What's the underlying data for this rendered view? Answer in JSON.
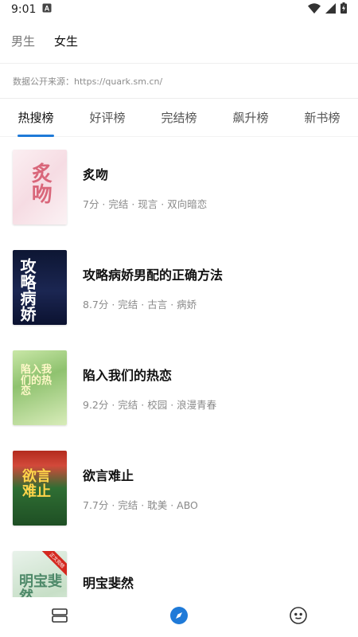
{
  "status_bar": {
    "time": "9:01",
    "icons": [
      "notification-a-icon",
      "wifi-icon",
      "signal-icon",
      "battery-charging-icon"
    ]
  },
  "gender_tabs": [
    {
      "label": "男生",
      "active": false
    },
    {
      "label": "女生",
      "active": true
    }
  ],
  "source_text": "数据公开来源：https://quark.sm.cn/",
  "rank_tabs": [
    {
      "label": "热搜榜",
      "active": true
    },
    {
      "label": "好评榜",
      "active": false
    },
    {
      "label": "完结榜",
      "active": false
    },
    {
      "label": "飙升榜",
      "active": false
    },
    {
      "label": "新书榜",
      "active": false
    }
  ],
  "books": [
    {
      "title": "炙吻",
      "meta": "7分 · 完结 · 现言 · 双向暗恋",
      "cover_text": "炙吻"
    },
    {
      "title": "攻略病娇男配的正确方法",
      "meta": "8.7分 · 完结 · 古言 · 病娇",
      "cover_text": "攻略病娇"
    },
    {
      "title": "陷入我们的热恋",
      "meta": "9.2分 · 完结 · 校园 · 浪漫青春",
      "cover_text": "陷入我们的热恋"
    },
    {
      "title": "欲言难止",
      "meta": "7.7分 · 完结 · 耽美 · ABO",
      "cover_text": "欲言难止"
    },
    {
      "title": "明宝斐然",
      "meta": "",
      "cover_text": "明宝斐然",
      "ribbon_text": "正文完结"
    }
  ],
  "bottom_nav": [
    {
      "icon": "bookshelf-icon",
      "active": false
    },
    {
      "icon": "discover-compass-icon",
      "active": true
    },
    {
      "icon": "profile-face-icon",
      "active": false
    }
  ],
  "colors": {
    "accent": "#1f7ad8",
    "text_primary": "#111111",
    "text_secondary": "#8a8a8a"
  }
}
